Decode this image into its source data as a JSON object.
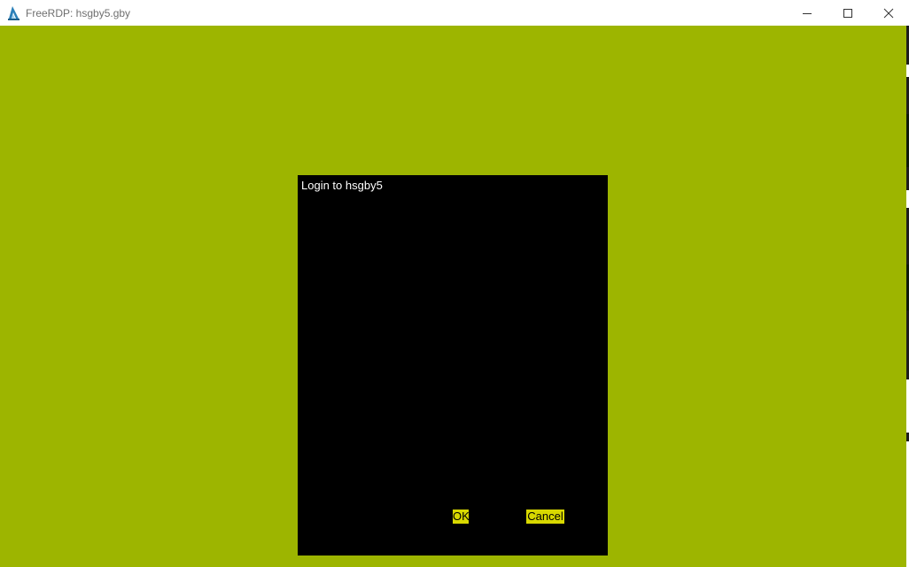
{
  "window": {
    "title": "FreeRDP: hsgby5.gby",
    "app_icon": "freerdp-icon",
    "controls": {
      "minimize": "minimize-icon",
      "maximize": "maximize-icon",
      "close": "close-icon"
    }
  },
  "colors": {
    "desktop_background": "#9db500",
    "dialog_background": "#000000",
    "button_background": "#d8d800",
    "dialog_text": "#ffffff"
  },
  "dialog": {
    "title": "Login to hsgby5",
    "ok_label": "OK",
    "cancel_label": "Cancel"
  }
}
